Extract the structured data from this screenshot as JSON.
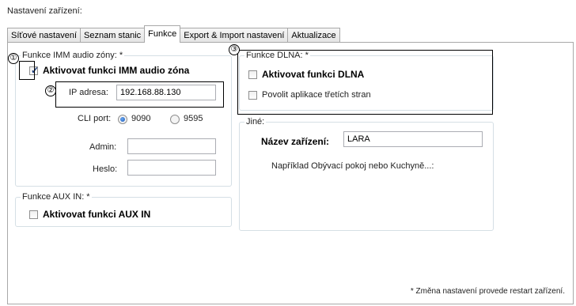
{
  "title": "Nastavení zařízení:",
  "tabs": [
    {
      "label": "Síťové nastavení"
    },
    {
      "label": "Seznam stanic"
    },
    {
      "label": "Funkce"
    },
    {
      "label": "Export & Import nastavení"
    },
    {
      "label": "Aktualizace"
    }
  ],
  "active_tab": "Funkce",
  "imm": {
    "legend": "Funkce IMM audio zóny: *",
    "checkbox_label": "Aktivovat funkci IMM audio zóna",
    "checked": true,
    "ip_label": "IP adresa:",
    "ip_value": "192.168.88.130",
    "cli_label": "CLI port:",
    "cli_options": [
      "9090",
      "9595"
    ],
    "cli_selected": "9090",
    "admin_label": "Admin:",
    "admin_value": "",
    "heslo_label": "Heslo:",
    "heslo_value": ""
  },
  "aux": {
    "legend": "Funkce AUX IN: *",
    "checkbox_label": "Aktivovat funkci AUX IN",
    "checked": false
  },
  "dlna": {
    "legend": "Funkce DLNA: *",
    "checkbox_label": "Aktivovat funkci DLNA",
    "checked": false,
    "third_party_label": "Povolit aplikace třetích stran",
    "third_party_checked": false
  },
  "other": {
    "legend": "Jiné:",
    "device_name_label": "Název zařízení:",
    "device_name_value": "LARA",
    "hint": "Například Obývací pokoj nebo Kuchyně...:"
  },
  "callouts": [
    "①",
    "②",
    "③"
  ],
  "footnote": "* Změna nastavení provede restart zařízení."
}
